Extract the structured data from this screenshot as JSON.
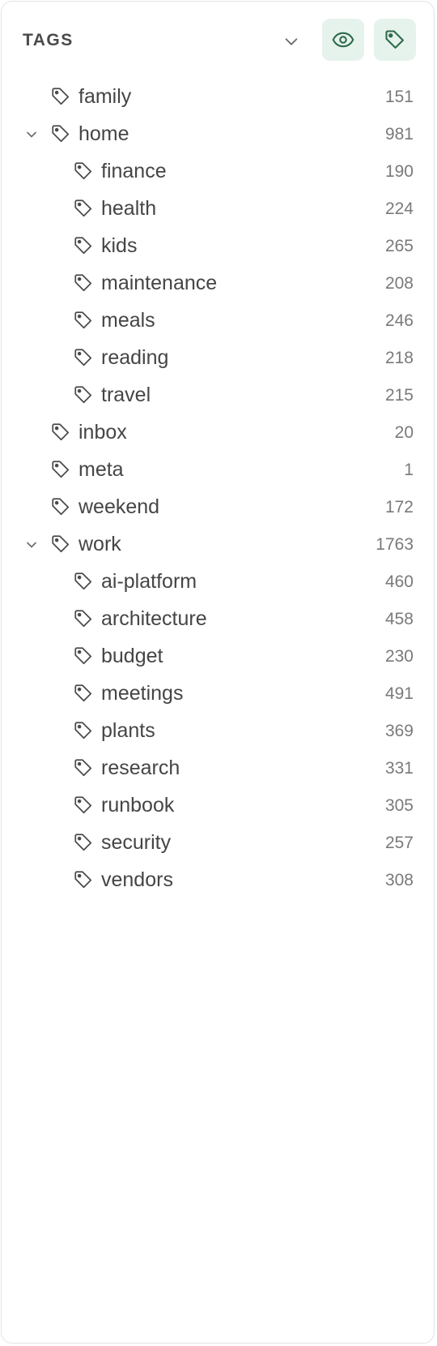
{
  "header": {
    "title": "TAGS",
    "collapse_icon": "chevron-down-icon",
    "visibility_icon": "eye-icon",
    "tag_action_icon": "tag-icon",
    "accent_bg": "#e6f3ec",
    "accent_fg": "#2f6b4a"
  },
  "tags": [
    {
      "name": "family",
      "count": "151"
    },
    {
      "name": "home",
      "count": "981",
      "expanded": true,
      "children": [
        {
          "name": "finance",
          "count": "190"
        },
        {
          "name": "health",
          "count": "224"
        },
        {
          "name": "kids",
          "count": "265"
        },
        {
          "name": "maintenance",
          "count": "208"
        },
        {
          "name": "meals",
          "count": "246"
        },
        {
          "name": "reading",
          "count": "218"
        },
        {
          "name": "travel",
          "count": "215"
        }
      ]
    },
    {
      "name": "inbox",
      "count": "20"
    },
    {
      "name": "meta",
      "count": "1"
    },
    {
      "name": "weekend",
      "count": "172"
    },
    {
      "name": "work",
      "count": "1763",
      "expanded": true,
      "children": [
        {
          "name": "ai-platform",
          "count": "460"
        },
        {
          "name": "architecture",
          "count": "458"
        },
        {
          "name": "budget",
          "count": "230"
        },
        {
          "name": "meetings",
          "count": "491"
        },
        {
          "name": "plants",
          "count": "369"
        },
        {
          "name": "research",
          "count": "331"
        },
        {
          "name": "runbook",
          "count": "305"
        },
        {
          "name": "security",
          "count": "257"
        },
        {
          "name": "vendors",
          "count": "308"
        }
      ]
    }
  ]
}
